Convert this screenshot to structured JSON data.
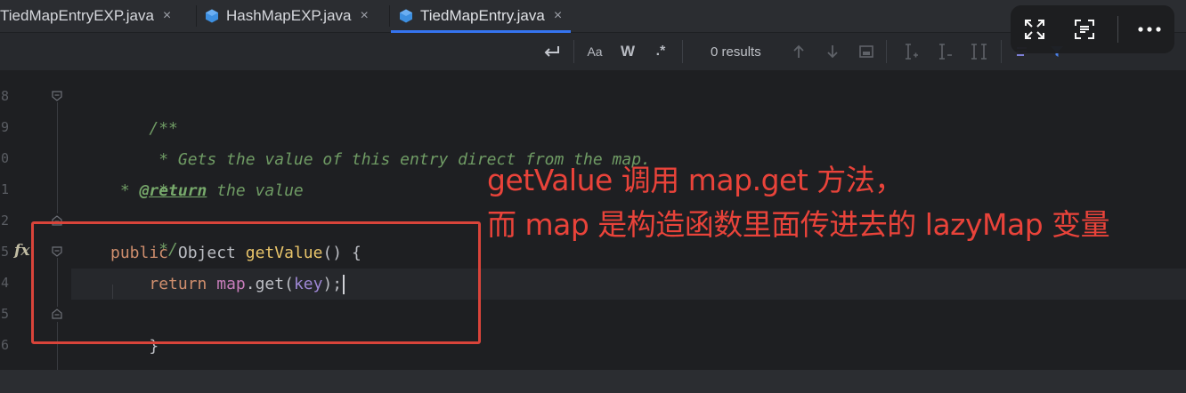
{
  "tabs": [
    {
      "label": "TiedMapEntryEXP.java",
      "close": "×",
      "active": false,
      "has_icon": false
    },
    {
      "label": "HashMapEXP.java",
      "close": "×",
      "active": false,
      "has_icon": true
    },
    {
      "label": "TiedMapEntry.java",
      "close": "×",
      "active": true,
      "has_icon": true
    }
  ],
  "find_toolbar": {
    "match_case_label": "Aa",
    "whole_word_label": "W",
    "regex_label": ".*",
    "results_text": "0 results"
  },
  "gutter": {
    "line_numbers": [
      "8",
      "9",
      "0",
      "1",
      "2",
      "5",
      "4",
      "5",
      "6"
    ],
    "fx_icon": "fx"
  },
  "code": {
    "line1": "/**",
    "line2": " * Gets the value of this entry direct from the map.",
    "line3": " *",
    "line4_prefix": " * ",
    "line4_tag": "@return",
    "line4_rest": " the value",
    "line5": " */",
    "line6_kw": "public",
    "line6_type": " Object ",
    "line6_fn": "getValue",
    "line6_rest": "() {",
    "line7_indent": "    ",
    "line7_kw": "return",
    "line7_field": "map",
    "line7_mid": ".get(",
    "line7_param": "key",
    "line7_end": ");",
    "line8": "}"
  },
  "annotation": {
    "line1": "getValue 调用 map.get 方法，",
    "line2": "而 map 是构造函数里面传进去的 lazyMap 变量"
  },
  "colors": {
    "accent": "#3574f0",
    "annotation_red": "#e9433a",
    "java_icon": "#3d8fe0"
  },
  "overlay_icons": [
    "expand-icon",
    "scan-text-icon",
    "more-icon"
  ]
}
